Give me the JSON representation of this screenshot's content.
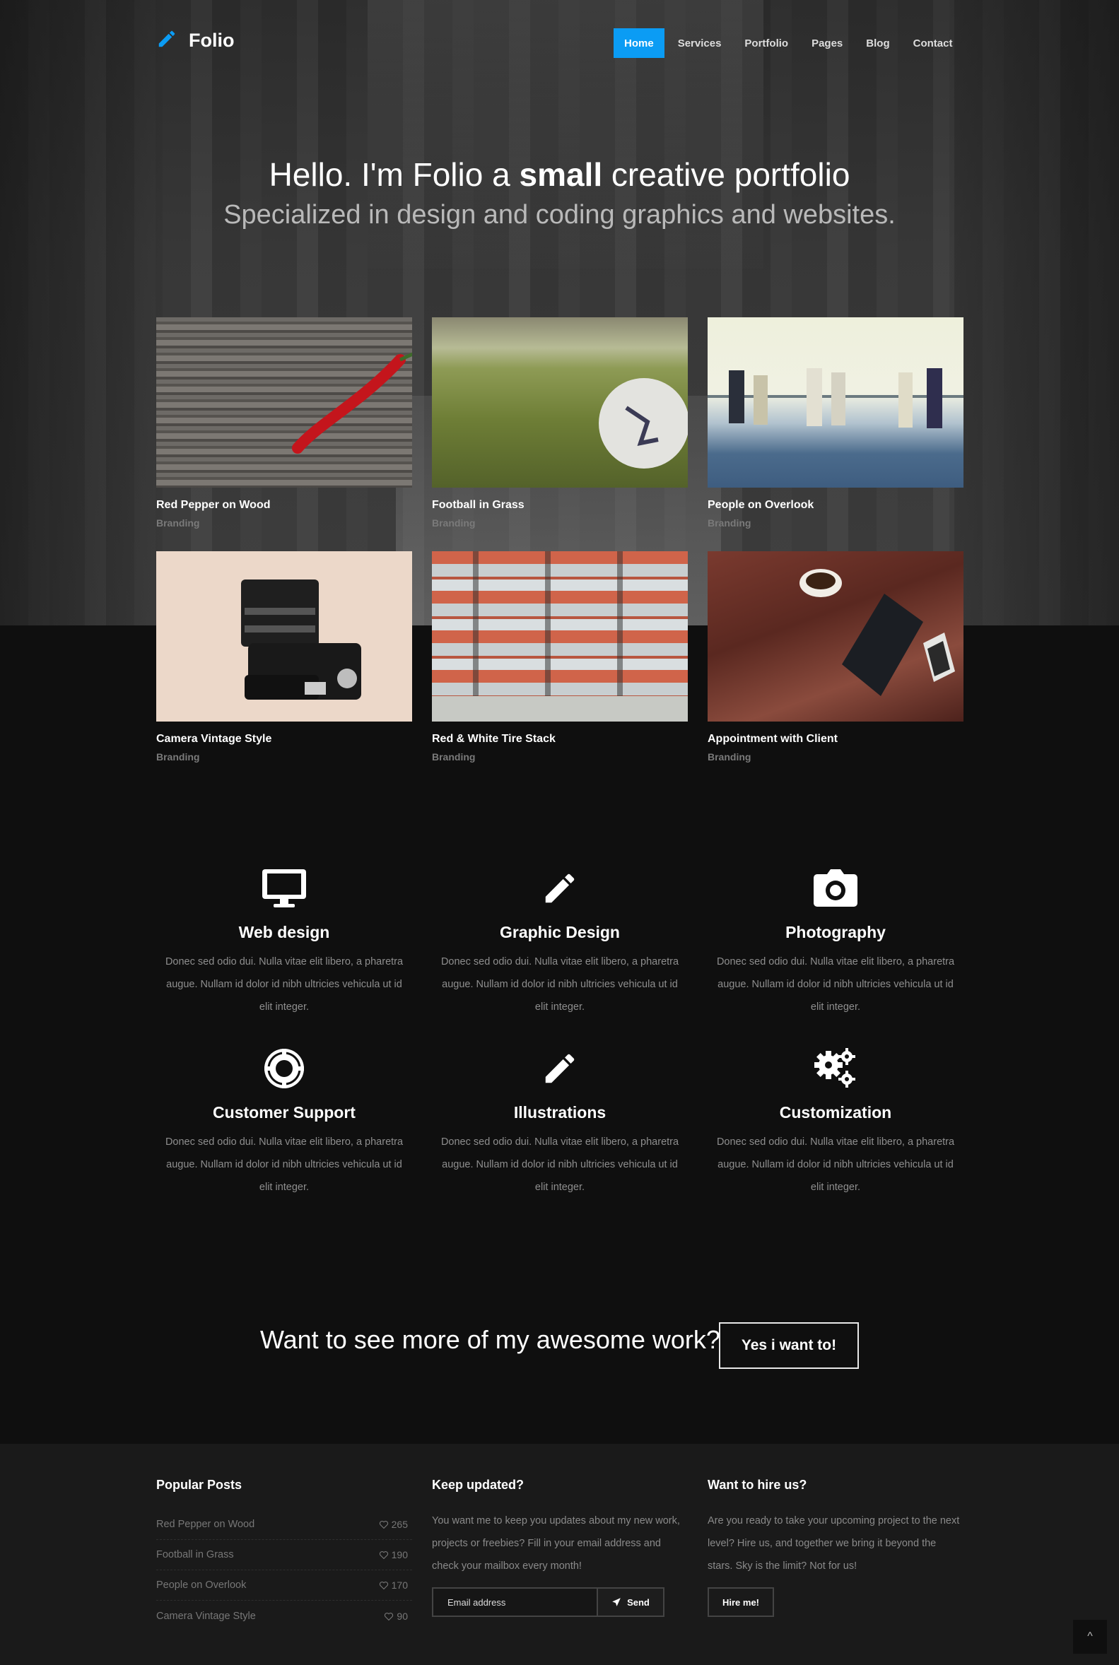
{
  "brand": {
    "name": "Folio",
    "icon": "pencil-icon",
    "accent": "#0b9cf4"
  },
  "nav": {
    "items": [
      {
        "label": "Home",
        "active": true
      },
      {
        "label": "Services",
        "active": false
      },
      {
        "label": "Portfolio",
        "active": false
      },
      {
        "label": "Pages",
        "active": false
      },
      {
        "label": "Blog",
        "active": false
      },
      {
        "label": "Contact",
        "active": false
      }
    ]
  },
  "hero": {
    "title_pre": "Hello. I'm Folio a ",
    "title_bold": "small",
    "title_post": " creative portfolio",
    "subtitle": "Specialized in design and coding graphics and websites."
  },
  "portfolio": [
    {
      "title": "Red Pepper on Wood",
      "category": "Branding"
    },
    {
      "title": "Football in Grass",
      "category": "Branding"
    },
    {
      "title": "People on Overlook",
      "category": "Branding"
    },
    {
      "title": "Camera Vintage Style",
      "category": "Branding"
    },
    {
      "title": "Red & White Tire Stack",
      "category": "Branding"
    },
    {
      "title": "Appointment with Client",
      "category": "Branding"
    }
  ],
  "services": [
    {
      "title": "Web design",
      "icon": "monitor-icon",
      "text": "Donec sed odio dui. Nulla vitae elit libero, a pharetra augue. Nullam id dolor id nibh ultricies vehicula ut id elit integer."
    },
    {
      "title": "Graphic Design",
      "icon": "pencil-icon",
      "text": "Donec sed odio dui. Nulla vitae elit libero, a pharetra augue. Nullam id dolor id nibh ultricies vehicula ut id elit integer."
    },
    {
      "title": "Photography",
      "icon": "camera-icon",
      "text": "Donec sed odio dui. Nulla vitae elit libero, a pharetra augue. Nullam id dolor id nibh ultricies vehicula ut id elit integer."
    },
    {
      "title": "Customer Support",
      "icon": "lifebuoy-icon",
      "text": "Donec sed odio dui. Nulla vitae elit libero, a pharetra augue. Nullam id dolor id nibh ultricies vehicula ut id elit integer."
    },
    {
      "title": "Illustrations",
      "icon": "pencil-icon",
      "text": "Donec sed odio dui. Nulla vitae elit libero, a pharetra augue. Nullam id dolor id nibh ultricies vehicula ut id elit integer."
    },
    {
      "title": "Customization",
      "icon": "gears-icon",
      "text": "Donec sed odio dui. Nulla vitae elit libero, a pharetra augue. Nullam id dolor id nibh ultricies vehicula ut id elit integer."
    }
  ],
  "cta": {
    "text": "Want to see more of my awesome work?",
    "button": "Yes i want to!"
  },
  "footer": {
    "popular": {
      "heading": "Popular Posts",
      "posts": [
        {
          "title": "Red Pepper on Wood",
          "likes": "265"
        },
        {
          "title": "Football in Grass",
          "likes": "190"
        },
        {
          "title": "People on Overlook",
          "likes": "170"
        },
        {
          "title": "Camera Vintage Style",
          "likes": "90"
        }
      ]
    },
    "updated": {
      "heading": "Keep updated?",
      "text": "You want me to keep you updates about my new work, projects or freebies? Fill in your email address and check your mailbox every month!",
      "email_placeholder": "Email address",
      "send_label": "Send"
    },
    "hire": {
      "heading": "Want to hire us?",
      "text": "Are you ready to take your upcoming project to the next level? Hire us, and together we bring it beyond the stars. Sky is the limit? Not for us!",
      "button": "Hire me!"
    }
  },
  "back_to_top": {
    "label": "^"
  }
}
